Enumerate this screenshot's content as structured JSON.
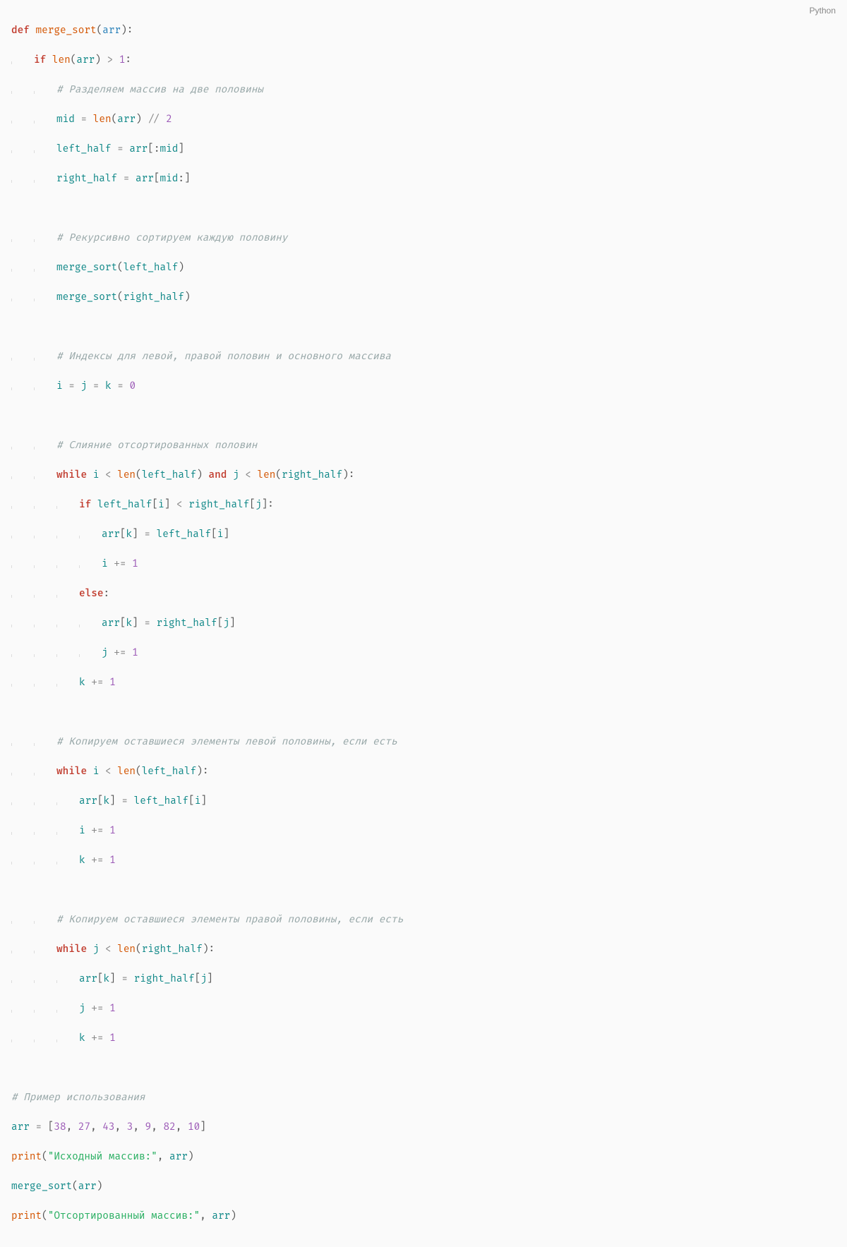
{
  "language_label": "Python",
  "code": {
    "l1_def": "def",
    "l1_fn": "merge_sort",
    "l1_param": "arr",
    "l2_if": "if",
    "l2_len": "len",
    "l2_arr": "arr",
    "l2_gt": ">",
    "l2_one": "1",
    "c1": "# Разделяем массив на две половины",
    "l3_mid": "mid",
    "l3_eq": "=",
    "l3_len": "len",
    "l3_arr": "arr",
    "l3_floor": "//",
    "l3_two": "2",
    "l4_lh": "left_half",
    "l4_eq": "=",
    "l4_arr": "arr",
    "l4_mid": "mid",
    "l5_rh": "right_half",
    "l5_eq": "=",
    "l5_arr": "arr",
    "l5_mid": "mid",
    "c2": "# Рекурсивно сортируем каждую половину",
    "l6_fn": "merge_sort",
    "l6_lh": "left_half",
    "l7_fn": "merge_sort",
    "l7_rh": "right_half",
    "c3": "# Индексы для левой, правой половин и основного массива",
    "l8_i": "i",
    "l8_j": "j",
    "l8_k": "k",
    "l8_eq": "=",
    "l8_zero": "0",
    "c4": "# Слияние отсортированных половин",
    "l9_while": "while",
    "l9_i": "i",
    "l9_lt1": "<",
    "l9_len1": "len",
    "l9_lh": "left_half",
    "l9_and": "and",
    "l9_j": "j",
    "l9_lt2": "<",
    "l9_len2": "len",
    "l9_rh": "right_half",
    "l10_if": "if",
    "l10_lh": "left_half",
    "l10_i": "i",
    "l10_lt": "<",
    "l10_rh": "right_half",
    "l10_j": "j",
    "l11_arr": "arr",
    "l11_k": "k",
    "l11_eq": "=",
    "l11_lh": "left_half",
    "l11_i": "i",
    "l12_i": "i",
    "l12_pe": "+=",
    "l12_one": "1",
    "l13_else": "else",
    "l14_arr": "arr",
    "l14_k": "k",
    "l14_eq": "=",
    "l14_rh": "right_half",
    "l14_j": "j",
    "l15_j": "j",
    "l15_pe": "+=",
    "l15_one": "1",
    "l16_k": "k",
    "l16_pe": "+=",
    "l16_one": "1",
    "c5": "# Копируем оставшиеся элементы левой половины, если есть",
    "l17_while": "while",
    "l17_i": "i",
    "l17_lt": "<",
    "l17_len": "len",
    "l17_lh": "left_half",
    "l18_arr": "arr",
    "l18_k": "k",
    "l18_eq": "=",
    "l18_lh": "left_half",
    "l18_i": "i",
    "l19_i": "i",
    "l19_pe": "+=",
    "l19_one": "1",
    "l20_k": "k",
    "l20_pe": "+=",
    "l20_one": "1",
    "c6": "# Копируем оставшиеся элементы правой половины, если есть",
    "l21_while": "while",
    "l21_j": "j",
    "l21_lt": "<",
    "l21_len": "len",
    "l21_rh": "right_half",
    "l22_arr": "arr",
    "l22_k": "k",
    "l22_eq": "=",
    "l22_rh": "right_half",
    "l22_j": "j",
    "l23_j": "j",
    "l23_pe": "+=",
    "l23_one": "1",
    "l24_k": "k",
    "l24_pe": "+=",
    "l24_one": "1",
    "c7": "# Пример использования",
    "l25_arr": "arr",
    "l25_eq": "=",
    "l25_vals": [
      "38",
      "27",
      "43",
      "3",
      "9",
      "82",
      "10"
    ],
    "l26_print": "print",
    "l26_str": "\"Исходный массив:\"",
    "l26_arr": "arr",
    "l27_fn": "merge_sort",
    "l27_arr": "arr",
    "l28_print": "print",
    "l28_str": "\"Отсортированный массив:\"",
    "l28_arr": "arr"
  }
}
